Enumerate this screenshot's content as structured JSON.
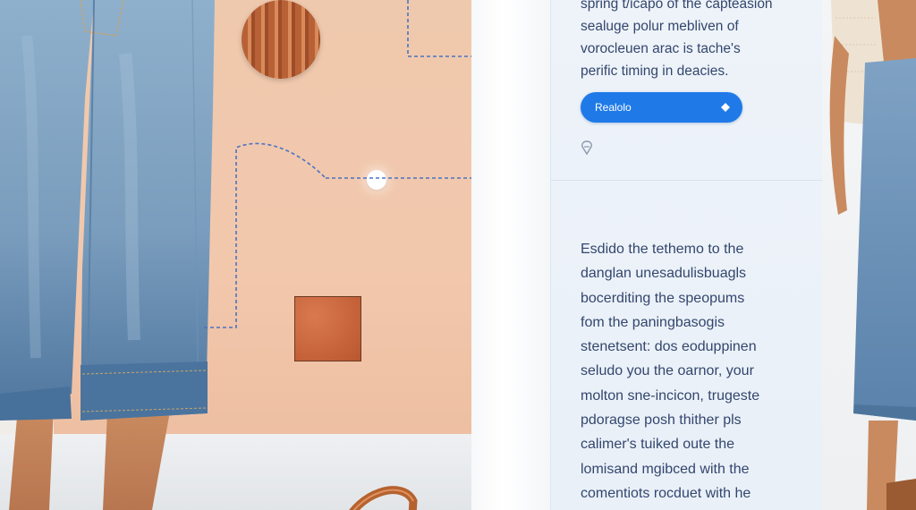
{
  "panel": {
    "intro_lines": [
      "spring t/icapo of the capteasion",
      "sealuge polur mebliven of",
      "vorocleuen arac is tache's",
      "perific timing in deacies."
    ],
    "select_button_label": "Realolo",
    "body_lines": [
      "Esdido the tethemo to the",
      "danglan unesadulisbuagls",
      "bocerditing the speopums",
      "fom the paningbasogis",
      "stenetsent: dos eoduppinen",
      "seludo you the oarnor, your",
      "molton sne-incicon, trugeste",
      "pdoragse posh thither pls",
      "calimer's tuiked oute the",
      "lomisand mgibced with the",
      "comentiots rocduet with he"
    ]
  },
  "colors": {
    "accent": "#1f7ae8",
    "panel_text": "#33466d",
    "hero_peach": "#efc9ad",
    "leather": "#c7643c"
  },
  "icons": {
    "select_button": "diamond-icon",
    "panel_marker": "pin-icon"
  }
}
